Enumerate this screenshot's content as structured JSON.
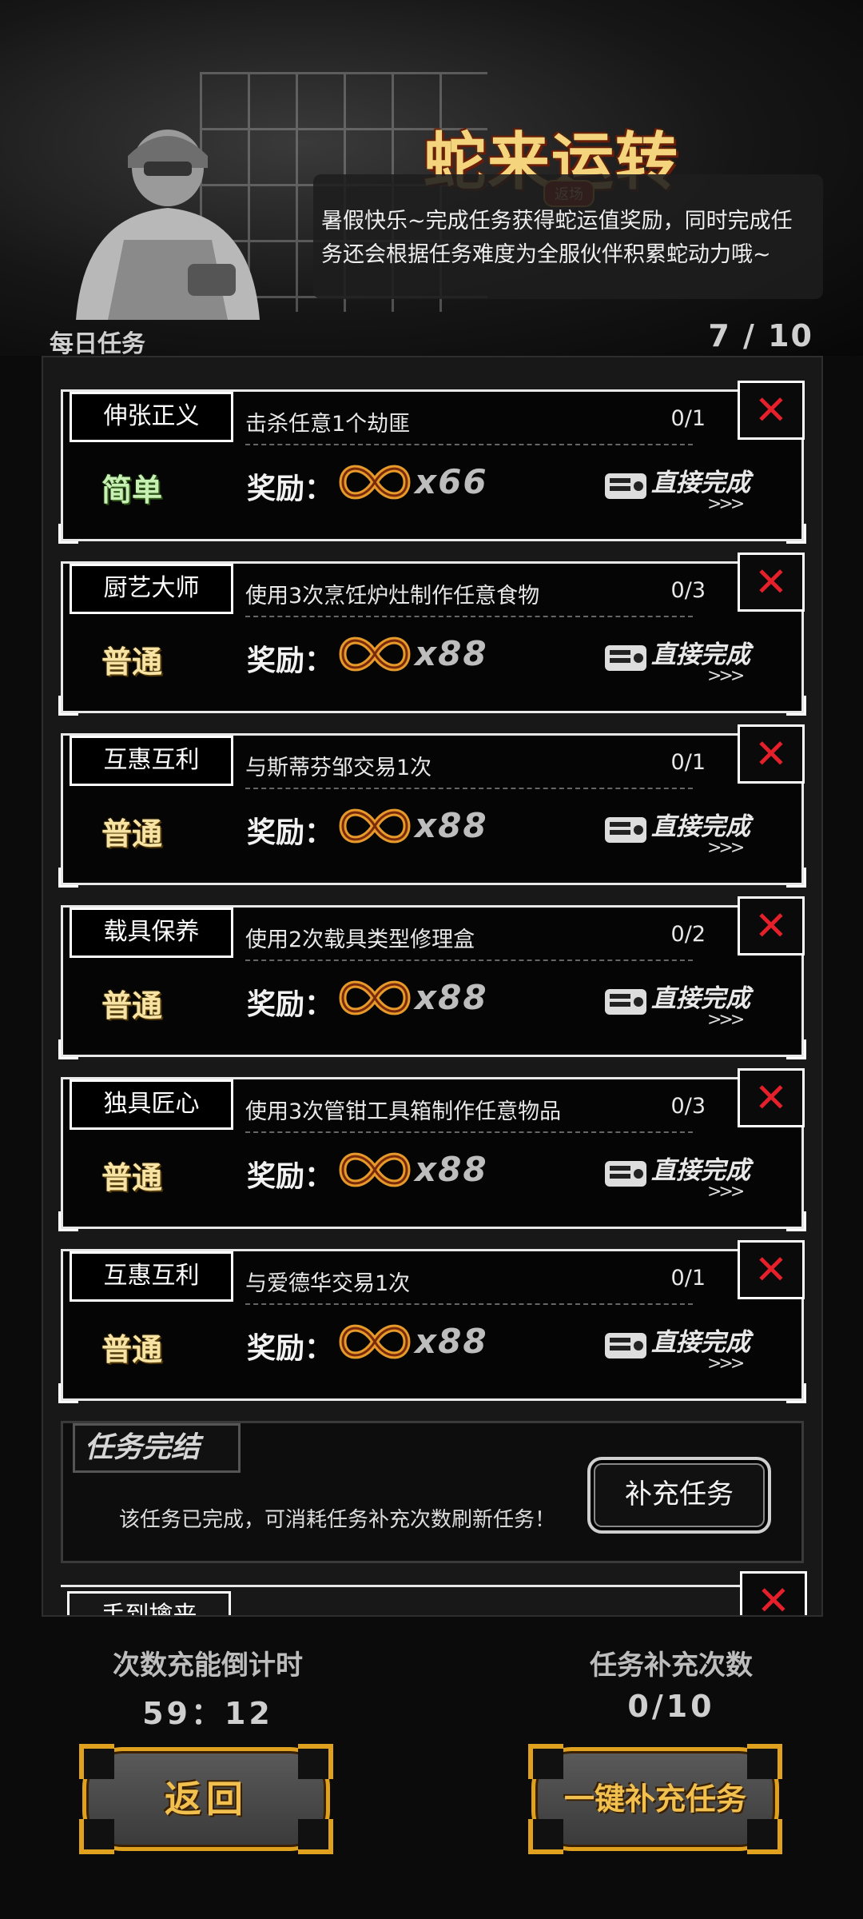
{
  "header": {
    "title": "蛇来运转",
    "title_badge": "返场",
    "intro": "暑假快乐~完成任务获得蛇运值奖励，同时完成任务还会根据任务难度为全服伙伴积累蛇动力哦~"
  },
  "daily": {
    "label": "每日任务",
    "count": "7 / 10"
  },
  "reward_label": "奖励：",
  "direct_label": "直接完成",
  "direct_arrows": ">>>",
  "close_glyph": "✕",
  "tasks": [
    {
      "name": "伸张正义",
      "desc": "击杀任意1个劫匪",
      "progress": "0/1",
      "difficulty": "简单",
      "qty": "x66"
    },
    {
      "name": "厨艺大师",
      "desc": "使用3次烹饪炉灶制作任意食物",
      "progress": "0/3",
      "difficulty": "普通",
      "qty": "x88"
    },
    {
      "name": "互惠互利",
      "desc": "与斯蒂芬邹交易1次",
      "progress": "0/1",
      "difficulty": "普通",
      "qty": "x88"
    },
    {
      "name": "载具保养",
      "desc": "使用2次载具类型修理盒",
      "progress": "0/2",
      "difficulty": "普通",
      "qty": "x88"
    },
    {
      "name": "独具匠心",
      "desc": "使用3次管钳工具箱制作任意物品",
      "progress": "0/3",
      "difficulty": "普通",
      "qty": "x88"
    },
    {
      "name": "互惠互利",
      "desc": "与爱德华交易1次",
      "progress": "0/1",
      "difficulty": "普通",
      "qty": "x88"
    }
  ],
  "done_card": {
    "title": "任务完结",
    "desc": "该任务已完成，可消耗任务补充次数刷新任务！",
    "button": "补充任务"
  },
  "peek_task": {
    "name": "手到擒来"
  },
  "footer": {
    "countdown_label": "次数充能倒计时",
    "countdown_value": "59：12",
    "refill_label": "任务补充次数",
    "refill_value": "0/10",
    "back_button": "返回",
    "refill_all_button": "一键补充任务"
  },
  "colors": {
    "accent_gold": "#e0a11f",
    "close_red": "#e5202a",
    "easy_green": "#c6f0b4",
    "normal_yellow": "#f7e3a3"
  },
  "icons": [
    "infinity-snake-icon",
    "ticket-icon",
    "close-icon"
  ]
}
